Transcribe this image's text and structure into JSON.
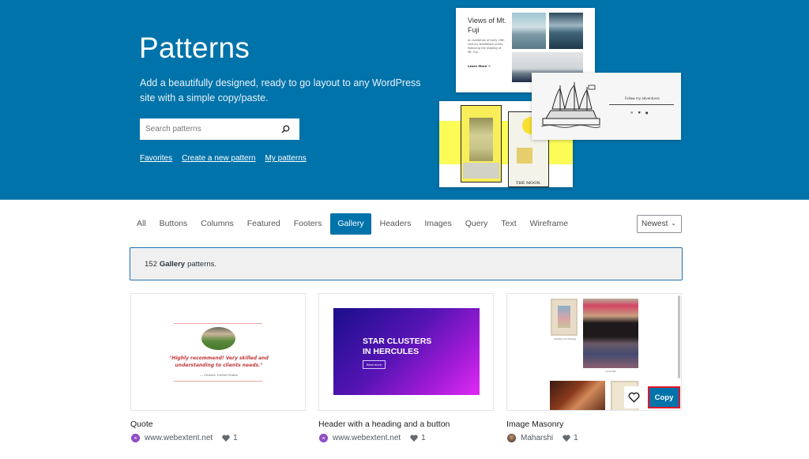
{
  "hero": {
    "title": "Patterns",
    "description": "Add a beautifully designed, ready to go layout to any WordPress site with a simple copy/paste.",
    "search": {
      "placeholder": "Search patterns",
      "value": ""
    },
    "links": [
      "Favorites",
      "Create a new pattern",
      "My patterns"
    ],
    "previews": {
      "fuji": {
        "title": "Views of Mt. Fuji",
        "text": "An exhibition of early 20th century woodblock prints featuring the majesty of Mt. Fuji.",
        "link": "Learn More →"
      },
      "ship": {
        "title": "Follow my adventures"
      },
      "tarot": {
        "card_label": "THE MOON."
      }
    }
  },
  "filters": {
    "tabs": [
      {
        "label": "All",
        "active": false
      },
      {
        "label": "Buttons",
        "active": false
      },
      {
        "label": "Columns",
        "active": false
      },
      {
        "label": "Featured",
        "active": false
      },
      {
        "label": "Footers",
        "active": false
      },
      {
        "label": "Gallery",
        "active": true
      },
      {
        "label": "Headers",
        "active": false
      },
      {
        "label": "Images",
        "active": false
      },
      {
        "label": "Query",
        "active": false
      },
      {
        "label": "Text",
        "active": false
      },
      {
        "label": "Wireframe",
        "active": false
      }
    ],
    "sort": {
      "selected": "Newest"
    }
  },
  "notice": {
    "count": "152",
    "category": "Gallery",
    "suffix": "patterns."
  },
  "patterns": [
    {
      "title": "Quote",
      "author": "www.webextent.net",
      "likes": "1",
      "preview": {
        "quote": "\"Highly recommend! Very skilled and understanding to clients needs.\"",
        "byline": "— Charles, United States"
      }
    },
    {
      "title": "Header with a heading and a button",
      "author": "www.webextent.net",
      "likes": "1",
      "preview": {
        "heading": "STAR CLUSTERS IN HERCULES",
        "button": "Read more"
      }
    },
    {
      "title": "Image Masonry",
      "author": "Maharshi",
      "likes": "1",
      "preview": {
        "caption1": "Liberality and Modesty",
        "caption2": "Lucille Ball"
      },
      "actions": {
        "copy": "Copy"
      }
    }
  ],
  "colors": {
    "brand": "#0073aa",
    "highlight": "#e0162b"
  }
}
